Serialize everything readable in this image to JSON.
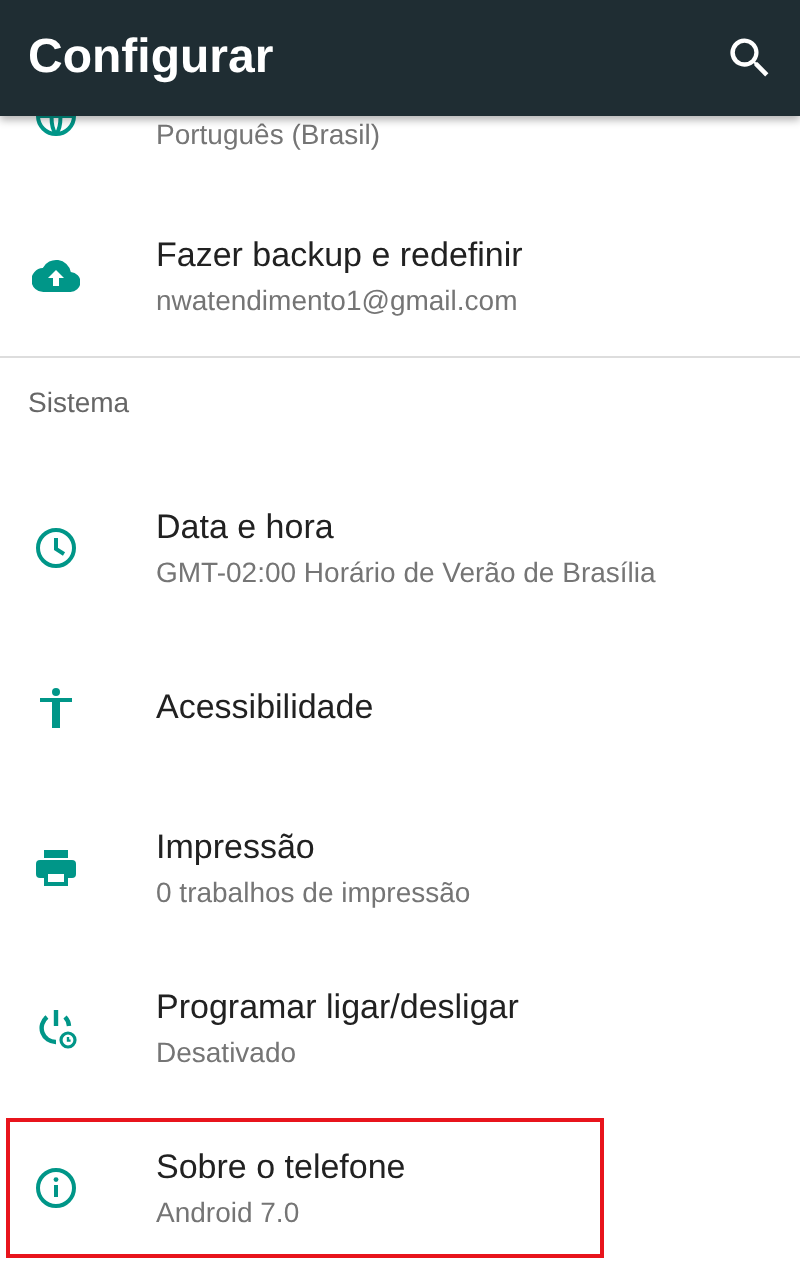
{
  "app_bar": {
    "title": "Configurar"
  },
  "items": [
    {
      "kind": "language",
      "subtitle": "Português (Brasil)",
      "partial": true,
      "highlighted": false
    },
    {
      "kind": "backup",
      "title": "Fazer backup e redefinir",
      "subtitle": "nwatendimento1@gmail.com",
      "highlighted": false
    },
    {
      "kind": "header",
      "title": "Sistema"
    },
    {
      "kind": "clock",
      "title": "Data e hora",
      "subtitle": "GMT-02:00 Horário de Verão de Brasília",
      "highlighted": false
    },
    {
      "kind": "accessibility",
      "title": "Acessibilidade",
      "highlighted": false
    },
    {
      "kind": "print",
      "title": "Impressão",
      "subtitle": "0 trabalhos de impressão",
      "highlighted": false
    },
    {
      "kind": "schedule",
      "title": "Programar ligar/desligar",
      "subtitle": "Desativado",
      "highlighted": false
    },
    {
      "kind": "info",
      "title": "Sobre o telefone",
      "subtitle": "Android 7.0",
      "highlighted": true
    }
  ]
}
